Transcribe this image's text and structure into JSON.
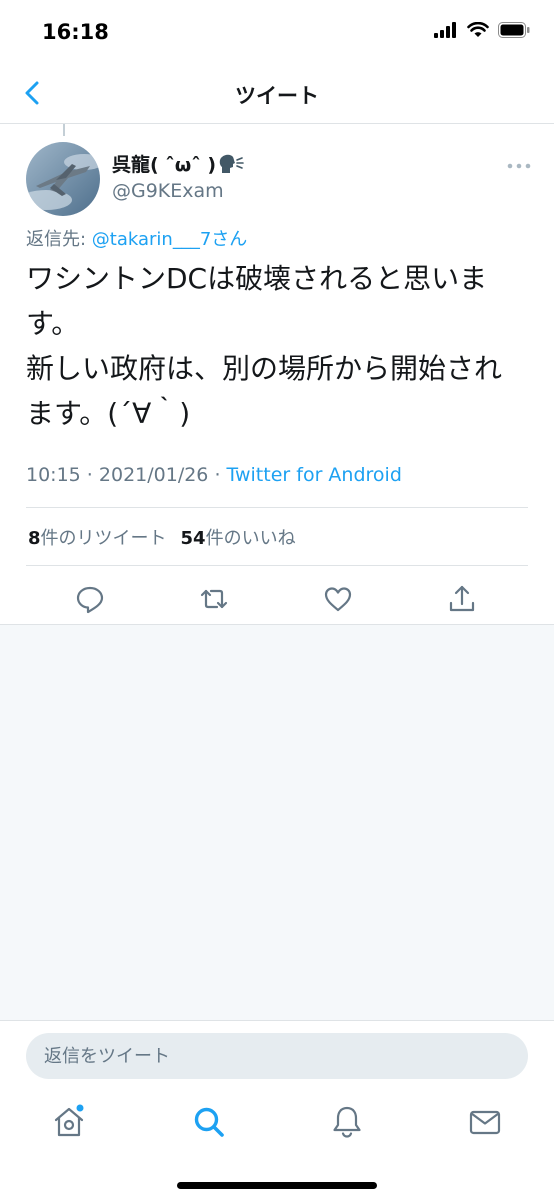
{
  "status_bar": {
    "time": "16:18"
  },
  "nav": {
    "title": "ツイート",
    "back_icon": "chevron-left-icon"
  },
  "tweet": {
    "display_name": "呉龍( ˆωˆ )",
    "handle": "@G9KExam",
    "reply_prefix": "返信先: ",
    "reply_mention": "@takarin___7",
    "reply_suffix": "さん",
    "text": "ワシントンDCは破壊されると思いま\nす。\n新しい政府は、別の場所から開始され\nます。(´∀｀)",
    "time": "10:15",
    "date": "2021/01/26",
    "meta_sep": " · ",
    "source": "Twitter for Android",
    "retweet_count": "8",
    "retweet_label": "件のリツイート",
    "like_count": "54",
    "like_label": "件のいいね"
  },
  "actions": [
    "reply-icon",
    "retweet-icon",
    "like-icon",
    "share-icon"
  ],
  "reply_bar": {
    "placeholder": "返信をツイート"
  },
  "tabs": [
    "home-icon",
    "search-icon",
    "notifications-icon",
    "messages-icon"
  ],
  "colors": {
    "accent": "#1da1f2",
    "muted": "#657786",
    "divider": "#dfe3e6",
    "background_gray": "#f5f8fa"
  }
}
